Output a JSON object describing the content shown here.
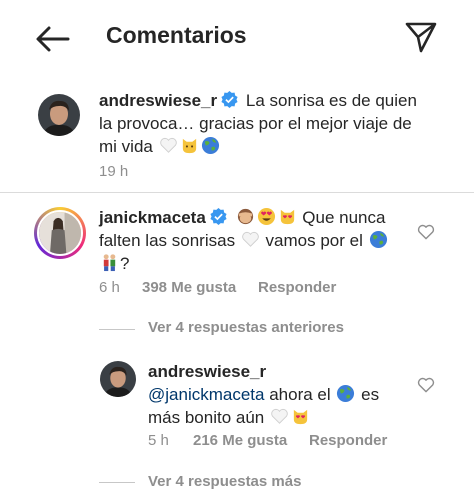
{
  "header": {
    "title": "Comentarios",
    "back_icon": "arrow-left-icon",
    "send_icon": "paper-plane-icon"
  },
  "caption": {
    "username": "andreswiese_r",
    "line1": "La sonrisa es de quien",
    "line2": "la provoca… gracias por el mejor viaje de",
    "line3": "mi vida",
    "time": "19 h"
  },
  "comment": {
    "username": "janickmaceta",
    "line1": "Que nunca",
    "line2a": "falten las sonrisas",
    "line2b": "vamos por el",
    "line3": "?",
    "time": "6 h",
    "likes": "398 Me gusta",
    "reply": "Responder",
    "view_previous": "Ver 4 respuestas anteriores"
  },
  "reply_comment": {
    "username": "andreswiese_r",
    "mention": "@janickmaceta",
    "line1": "ahora el",
    "line1b": "es",
    "line2": "más bonito aún",
    "time": "5 h",
    "likes": "216 Me gusta",
    "reply": "Responder",
    "view_more": "Ver 4 respuestas más"
  },
  "colors": {
    "verified": "#3897f0",
    "secondary_text": "#8e8e8e",
    "mention": "#00376b",
    "divider": "#dbdbdb"
  }
}
